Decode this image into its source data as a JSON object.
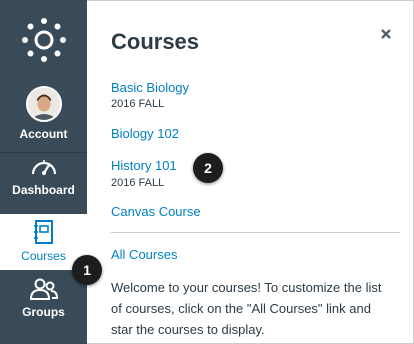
{
  "nav": {
    "logo_icon": "canvas-logo-icon",
    "items": [
      {
        "label": "Account",
        "icon": "avatar-photo"
      },
      {
        "label": "Dashboard",
        "icon": "dashboard-gauge-icon"
      },
      {
        "label": "Courses",
        "icon": "courses-book-icon",
        "active": true
      },
      {
        "label": "Groups",
        "icon": "groups-people-icon"
      }
    ]
  },
  "tray": {
    "title": "Courses",
    "close_icon": "close-icon",
    "courses": [
      {
        "name": "Basic Biology",
        "term": "2016 FALL"
      },
      {
        "name": "Biology 102",
        "term": ""
      },
      {
        "name": "History 101",
        "term": "2016 FALL"
      },
      {
        "name": "Canvas Course",
        "term": ""
      }
    ],
    "all_courses_label": "All Courses",
    "welcome_text": "Welcome to your courses! To customize the list of courses, click on the \"All Courses\" link and star the courses to display."
  },
  "callouts": [
    "1",
    "2"
  ],
  "colors": {
    "nav_bg": "#394b58",
    "link": "#0081c4",
    "text": "#2d3b45",
    "badge": "#1d1d1d"
  }
}
